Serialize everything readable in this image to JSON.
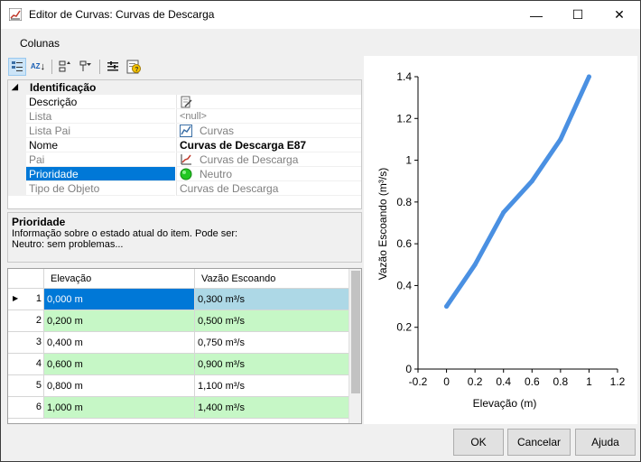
{
  "window": {
    "title": "Editor de Curvas: Curvas de Descarga",
    "minimize_glyph": "—",
    "maximize_glyph": "☐",
    "close_glyph": "✕"
  },
  "menu": {
    "columns_label": "Colunas"
  },
  "toolbar": {
    "icons": [
      "categorized-icon",
      "sort-alpha-icon",
      "expand-icon",
      "filter-icon",
      "properties-icon",
      "help-icon"
    ],
    "sort_label": "AZ"
  },
  "property_grid": {
    "category": "Identificação",
    "rows": [
      {
        "name": "Descrição",
        "value": "",
        "icon": "edit-note-icon",
        "readonly": false
      },
      {
        "name": "Lista",
        "value": "<null>",
        "readonly": true
      },
      {
        "name": "Lista Pai",
        "value": "Curvas",
        "icon": "chart-list-icon",
        "readonly": true
      },
      {
        "name": "Nome",
        "value": "Curvas de Descarga E87",
        "readonly": false,
        "bold": true
      },
      {
        "name": "Pai",
        "value": "Curvas de Descarga",
        "icon": "curve-icon",
        "readonly": true
      },
      {
        "name": "Prioridade",
        "value": "Neutro",
        "icon": "green-status-icon",
        "readonly": false,
        "selected": true
      },
      {
        "name": "Tipo de Objeto",
        "value": "Curvas de Descarga",
        "readonly": true
      }
    ]
  },
  "help": {
    "title": "Prioridade",
    "line1": "Informação sobre o estado atual do item. Pode ser:",
    "line2": "Neutro: sem problemas..."
  },
  "data_grid": {
    "columns": [
      "Elevação",
      "Vazão Escoando"
    ],
    "rows": [
      {
        "n": "1",
        "elev": "0,000 m",
        "flow": "0,300 m³/s"
      },
      {
        "n": "2",
        "elev": "0,200 m",
        "flow": "0,500 m³/s"
      },
      {
        "n": "3",
        "elev": "0,400 m",
        "flow": "0,750 m³/s"
      },
      {
        "n": "4",
        "elev": "0,600 m",
        "flow": "0,900 m³/s"
      },
      {
        "n": "5",
        "elev": "0,800 m",
        "flow": "1,100 m³/s"
      },
      {
        "n": "6",
        "elev": "1,000 m",
        "flow": "1,400 m³/s"
      }
    ],
    "current_row_pointer": "▶",
    "colors": {
      "selected": "#0078d7",
      "current": "#add8e6",
      "alt": "#c6f7c6"
    }
  },
  "chart_data": {
    "type": "line",
    "x": [
      0,
      0.2,
      0.4,
      0.6,
      0.8,
      1.0
    ],
    "series": [
      {
        "values": [
          0.3,
          0.5,
          0.75,
          0.9,
          1.1,
          1.4
        ]
      }
    ],
    "xlabel": "Elevação (m)",
    "ylabel": "Vazão Escoando (m³/s)",
    "xlim": [
      -0.2,
      1.2
    ],
    "ylim": [
      0,
      1.4
    ],
    "xticks": [
      "-0.2",
      "0",
      "0.2",
      "0.4",
      "0.6",
      "0.8",
      "1",
      "1.2"
    ],
    "yticks": [
      "0",
      "0.2",
      "0.4",
      "0.6",
      "0.8",
      "1",
      "1.2",
      "1.4"
    ],
    "line_color": "#4a90e2",
    "grid": false
  },
  "buttons": {
    "ok": "OK",
    "cancel": "Cancelar",
    "help": "Ajuda"
  }
}
